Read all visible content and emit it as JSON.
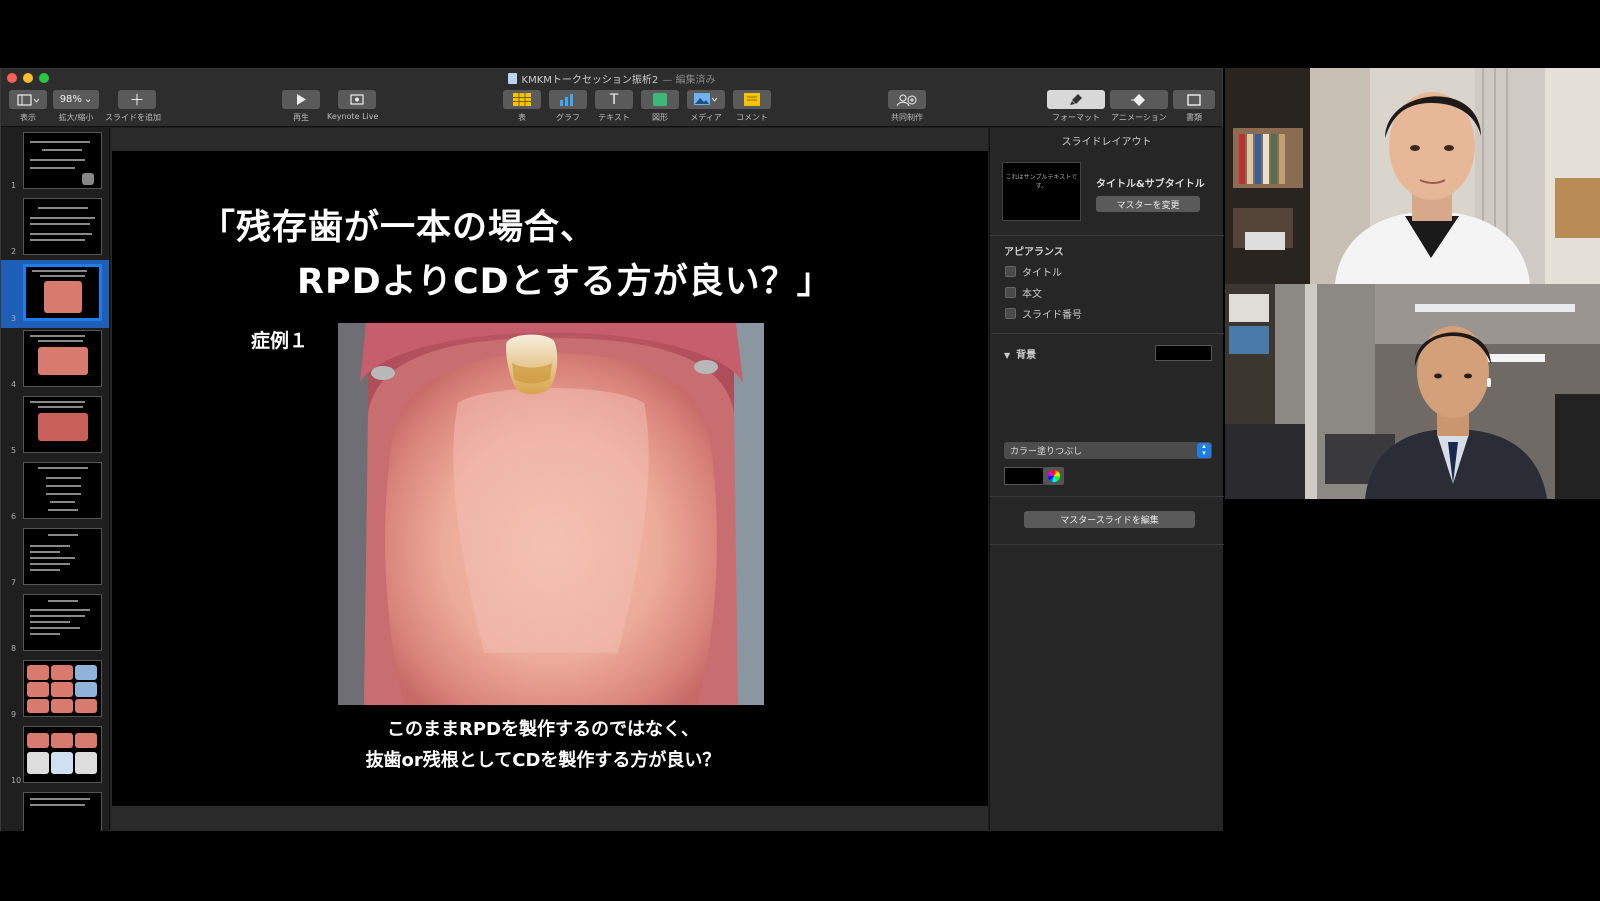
{
  "window": {
    "title": "KMKMトークセッション振析2",
    "status": "— 編集済み"
  },
  "toolbar": {
    "view_label": "表示",
    "zoom_value": "98%",
    "zoom_label": "拡大/縮小",
    "add_slide_label": "スライドを追加",
    "play_label": "再生",
    "keynote_live_label": "Keynote Live",
    "table_label": "表",
    "chart_label": "グラフ",
    "text_label": "テキスト",
    "shape_label": "図形",
    "media_label": "メディア",
    "comment_label": "コメント",
    "collaborate_label": "共同制作",
    "format_label": "フォーマット",
    "animate_label": "アニメーション",
    "document_label": "書類"
  },
  "navigator": {
    "slides": [
      "1",
      "2",
      "3",
      "4",
      "5",
      "6",
      "7",
      "8",
      "9",
      "10"
    ],
    "selected": "3"
  },
  "slide": {
    "title_line1": "「残存歯が一本の場合、",
    "title_line2": "RPDよりCDとする方が良い？」",
    "case_label": "症例１",
    "caption_line1": "このままRPDを製作するのではなく、",
    "caption_line2": "抜歯or残根としてCDを製作する方が良い？"
  },
  "inspector": {
    "header": "スライドレイアウト",
    "thumb_text": "これはサンプルテキストです。",
    "layout_name": "タイトル&サブタイトル",
    "change_master_label": "マスターを変更",
    "appearance_title": "アピアランス",
    "appearance_items": [
      "タイトル",
      "本文",
      "スライド番号"
    ],
    "background_title": "背景",
    "fill_type": "カラー塗りつぶし",
    "edit_master_label": "マスタースライドを編集",
    "bg_color": "#000000"
  },
  "colors": {
    "accent": "#1f7de8",
    "window_bg": "#1e1e1e"
  }
}
